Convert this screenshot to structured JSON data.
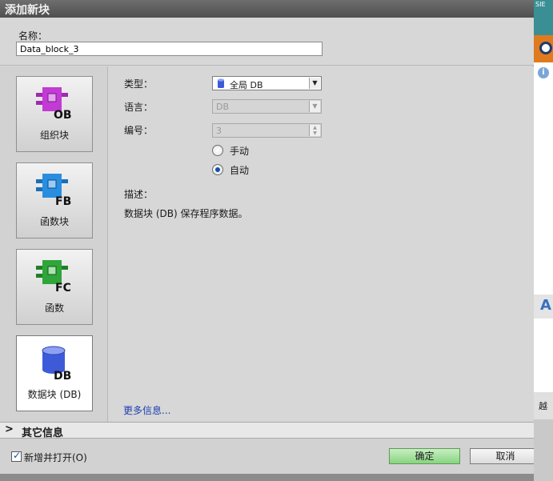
{
  "dialog": {
    "title": "添加新块",
    "name_label": "名称：",
    "name_value": "Data_block_3"
  },
  "block_types": [
    {
      "label": "组织块",
      "code": "OB",
      "color": "#c23bd4",
      "selected": false,
      "icon": "organization-block-icon"
    },
    {
      "label": "函数块",
      "code": "FB",
      "color": "#2a8ee0",
      "selected": false,
      "icon": "function-block-icon"
    },
    {
      "label": "函数",
      "code": "FC",
      "color": "#2fa53a",
      "selected": false,
      "icon": "function-icon"
    },
    {
      "label": "数据块 (DB)",
      "code": "DB",
      "color": "#3d5bd9",
      "selected": true,
      "icon": "data-block-icon"
    }
  ],
  "form": {
    "type_label": "类型：",
    "type_value": "全局 DB",
    "language_label": "语言：",
    "language_value": "DB",
    "number_label": "编号：",
    "number_value": "3",
    "manual_label": "手动",
    "auto_label": "自动",
    "numbering_mode": "auto",
    "description_label": "描述：",
    "description_text": "数据块 (DB) 保存程序数据。",
    "more_info": "更多信息..."
  },
  "other_info": {
    "label": "其它信息"
  },
  "footer": {
    "add_open_label": "新增并打开(O)",
    "add_open_checked": true,
    "ok_label": "确定",
    "cancel_label": "取消"
  },
  "side": {
    "top_text": "SIE",
    "bottom_text": "越"
  },
  "colors": {
    "ok_button": "#87d47f",
    "link": "#1f3fb0"
  }
}
